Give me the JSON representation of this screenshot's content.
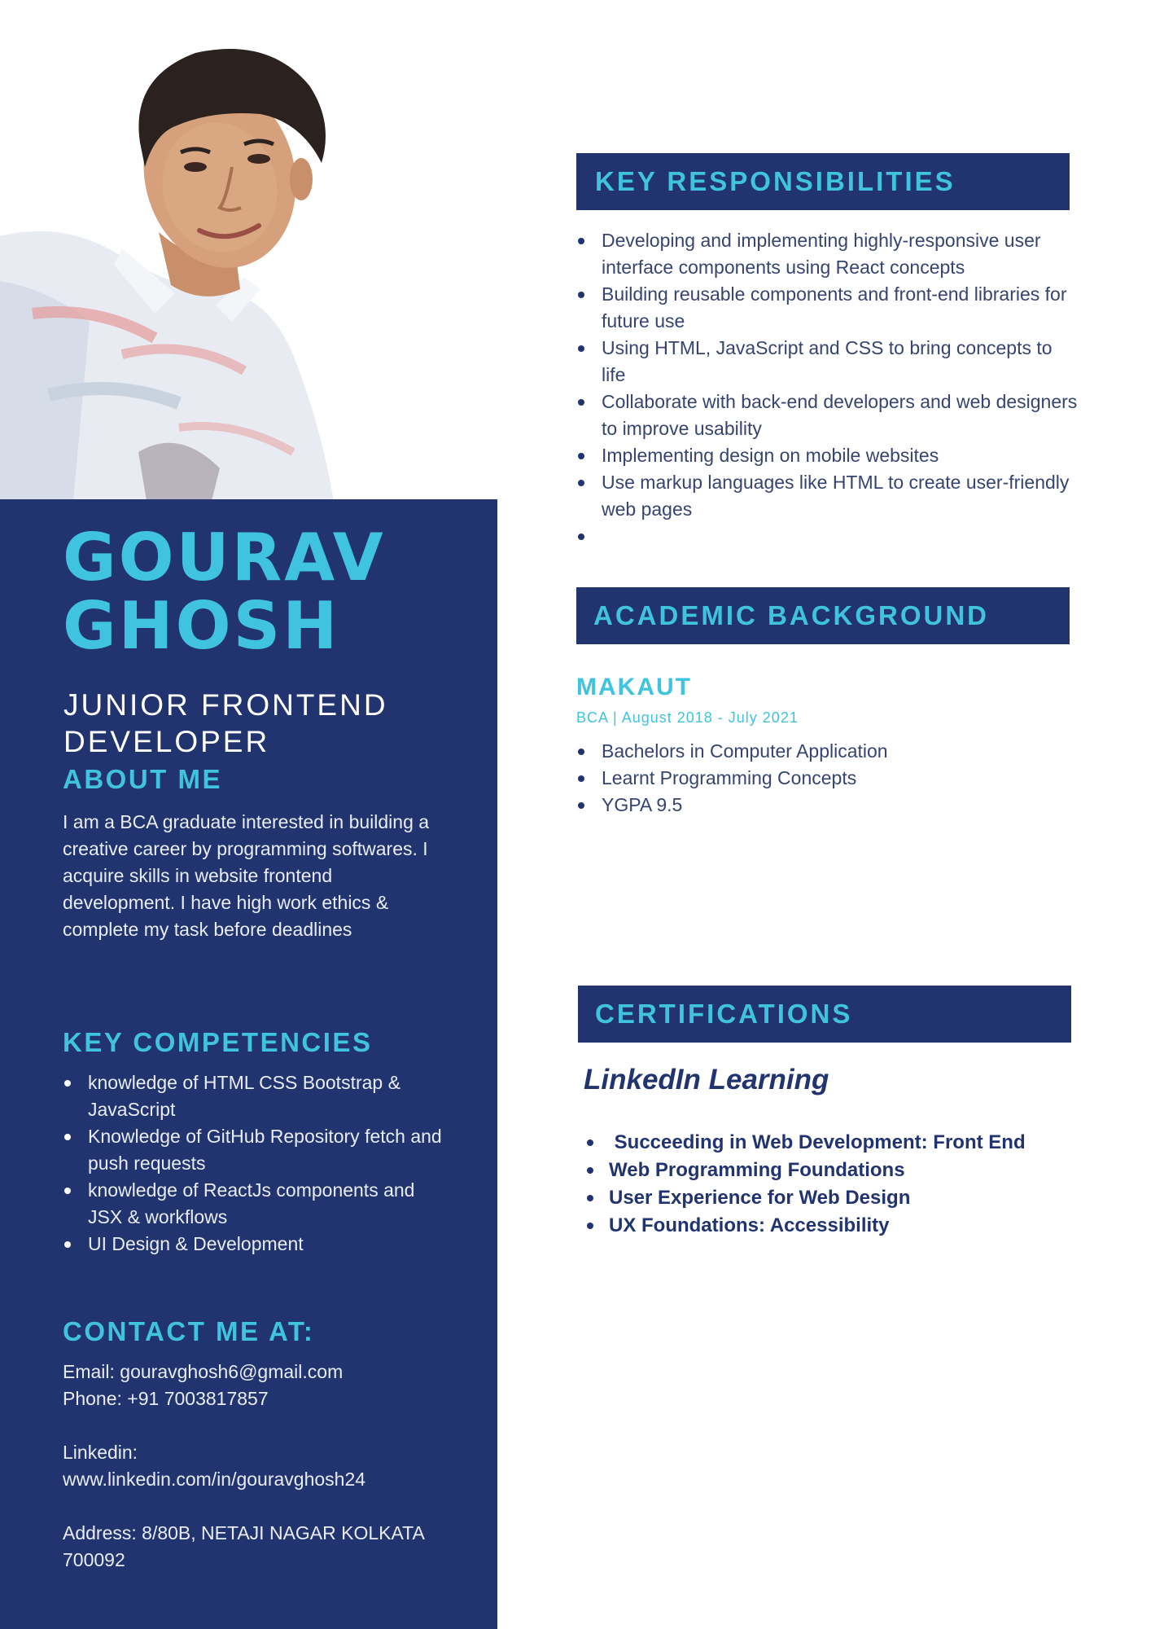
{
  "profile": {
    "first_name": "GOURAV",
    "last_name": "GHOSH",
    "role_line1": "JUNIOR FRONTEND",
    "role_line2": "DEVELOPER"
  },
  "about": {
    "heading": "ABOUT ME",
    "text": "I am a BCA graduate interested in building a creative career by programming softwares. I acquire skills in website frontend development. I have high work ethics & complete my task before deadlines"
  },
  "competencies": {
    "heading": "KEY COMPETENCIES",
    "items": [
      "knowledge of HTML CSS Bootstrap & JavaScript",
      "Knowledge of GitHub  Repository fetch and push requests",
      "knowledge of ReactJs  components and JSX & workflows",
      "UI Design & Development"
    ]
  },
  "contact": {
    "heading": "CONTACT ME AT:",
    "email": "Email: gouravghosh6@gmail.com",
    "phone": "Phone: +91 7003817857",
    "linkedin_label": "Linkedin:",
    "linkedin_url": "www.linkedin.com/in/gouravghosh24",
    "address_line1": "Address: 8/80B, NETAJI NAGAR KOLKATA",
    "address_line2": "700092"
  },
  "responsibilities": {
    "heading": "KEY RESPONSIBILITIES",
    "items": [
      "Developing and implementing highly-responsive user interface components using React concepts",
      "Building reusable components and front-end libraries for future use",
      "Using HTML, JavaScript and CSS to bring concepts to life",
      "Collaborate with back-end developers and web designers to improve usability",
      "Implementing design on mobile websites",
      "Use markup languages like HTML to create user-friendly web pages",
      ""
    ]
  },
  "academic": {
    "heading": "ACADEMIC BACKGROUND",
    "school": "MAKAUT",
    "meta": "BCA | August 2018 - July 2021",
    "items": [
      "Bachelors in Computer Application",
      "Learnt Programming Concepts",
      "YGPA 9.5"
    ]
  },
  "certifications": {
    "heading": "CERTIFICATIONS",
    "provider": "LinkedIn Learning",
    "items": [
      " Succeeding in Web Development: Front End",
      "Web Programming Foundations",
      "User Experience for Web Design",
      "UX Foundations: Accessibility"
    ]
  },
  "colors": {
    "navy": "#21346f",
    "accent_cyan": "#3fc3de",
    "body_text": "#36446f"
  }
}
